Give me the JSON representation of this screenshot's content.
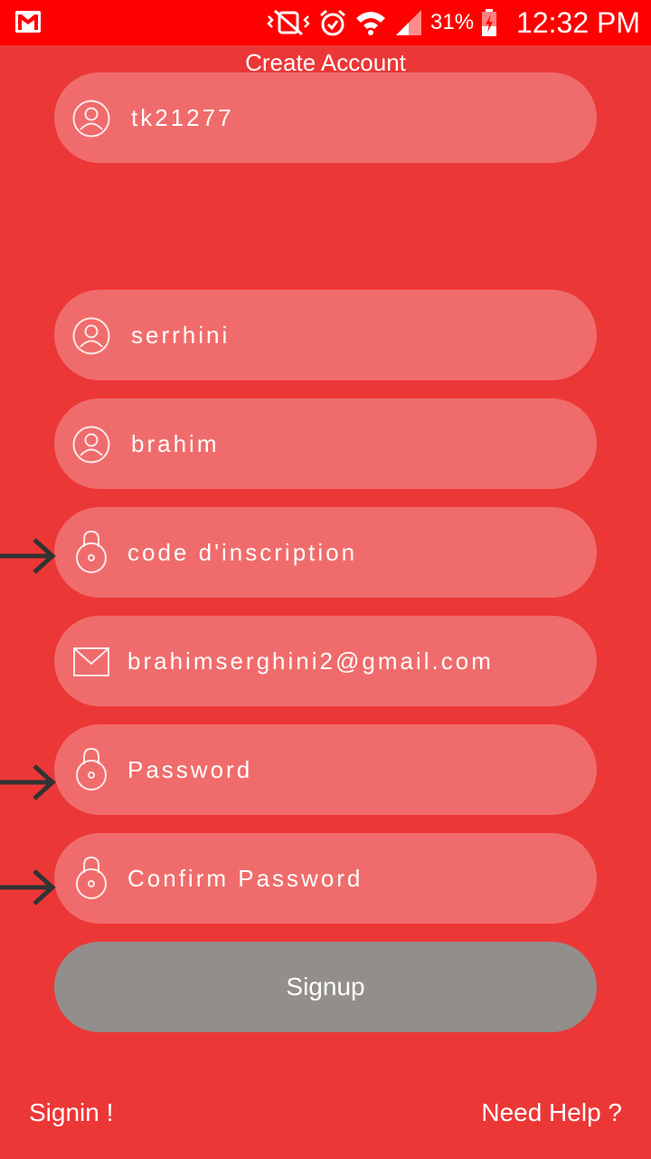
{
  "status_bar": {
    "battery_percent": "31%",
    "time": "12:32 PM",
    "icons": [
      "gmail-icon",
      "vibrate-icon",
      "alarm-icon",
      "wifi-icon",
      "signal-icon",
      "battery-charging-icon"
    ]
  },
  "page": {
    "title": "Create Account"
  },
  "fields": {
    "username": {
      "value": "tk21277",
      "icon": "user-icon"
    },
    "last_name": {
      "value": "serrhini",
      "icon": "user-icon"
    },
    "first_name": {
      "value": "brahim",
      "icon": "user-icon"
    },
    "registration_code": {
      "placeholder": "code d'inscription",
      "icon": "lock-icon"
    },
    "email": {
      "value": "brahimserghini2@gmail.com",
      "icon": "mail-icon"
    },
    "password": {
      "placeholder": "Password",
      "icon": "lock-icon"
    },
    "confirm_password": {
      "placeholder": "Confirm Password",
      "icon": "lock-icon"
    }
  },
  "buttons": {
    "signup": "Signup"
  },
  "links": {
    "signin": "Signin !",
    "help": "Need Help ?"
  },
  "colors": {
    "background": "#EC3737",
    "status_bar": "#FF0000",
    "field": "#F06C6C",
    "button": "#928E8B",
    "arrow": "#333333"
  }
}
